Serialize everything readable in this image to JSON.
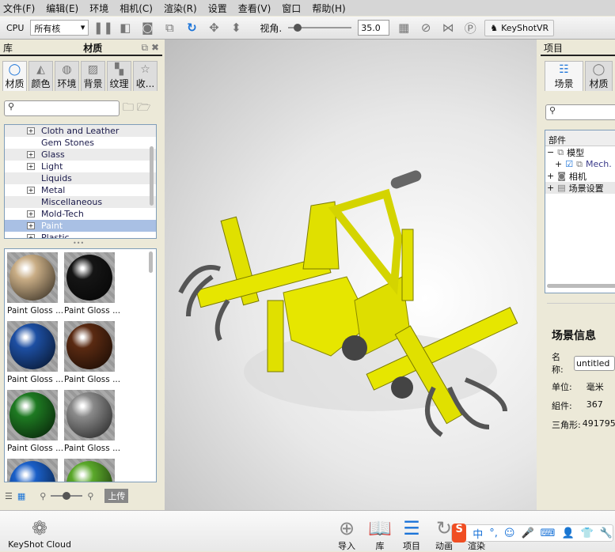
{
  "menu": [
    "文件(F)",
    "编辑(E)",
    "环境",
    "相机(C)",
    "渲染(R)",
    "设置",
    "查看(V)",
    "窗口",
    "帮助(H)"
  ],
  "toolbar": {
    "cpu_label": "CPU",
    "cpu_select": "所有核",
    "fov_label": "视角.",
    "fov_value": "35.0",
    "fov_slider": 0.1,
    "keyshotvr": "KeyShotVR"
  },
  "library": {
    "title_left": "库",
    "title": "材质",
    "tabs": [
      "材质",
      "颜色",
      "环境",
      "背景",
      "纹理",
      "收..."
    ],
    "tab_icons": [
      "material-icon",
      "color-icon",
      "globe-icon",
      "image-icon",
      "texture-icon",
      "star-icon"
    ],
    "tree": [
      {
        "label": "Cloth and Leather",
        "exp": true
      },
      {
        "label": "Gem Stones",
        "exp": false
      },
      {
        "label": "Glass",
        "exp": true
      },
      {
        "label": "Light",
        "exp": true
      },
      {
        "label": "Liquids",
        "exp": false
      },
      {
        "label": "Metal",
        "exp": true
      },
      {
        "label": "Miscellaneous",
        "exp": false
      },
      {
        "label": "Mold-Tech",
        "exp": true
      },
      {
        "label": "Paint",
        "exp": true,
        "selected": true
      },
      {
        "label": "Plastic",
        "exp": true
      }
    ],
    "materials": [
      {
        "label": "Paint Gloss ...",
        "color": "#c9ad85"
      },
      {
        "label": "Paint Gloss ...",
        "color": "#151515"
      },
      {
        "label": "Paint Gloss ...",
        "color": "#1d4fa3"
      },
      {
        "label": "Paint Gloss ...",
        "color": "#5a2a12"
      },
      {
        "label": "Paint Gloss ...",
        "color": "#1e7a22"
      },
      {
        "label": "Paint Gloss ...",
        "color": "#8a8a8a"
      },
      {
        "label": "Paint Gloss ...",
        "color": "#1a5fc8"
      },
      {
        "label": "Paint Gloss ...",
        "color": "#5aa82a"
      }
    ],
    "upload": "上传",
    "thumb_size": 0.5
  },
  "project": {
    "title": "项目",
    "tabs": [
      "场景",
      "材质"
    ],
    "tree_header": "部件",
    "tree": [
      {
        "label": "模型",
        "sign": "−"
      },
      {
        "label": "Mech.",
        "sign": "+",
        "child": true
      },
      {
        "label": "相机",
        "sign": "+"
      },
      {
        "label": "场景设置",
        "sign": "+"
      }
    ],
    "info_title": "场景信息",
    "name_label": "名称:",
    "name_value": "untitled",
    "unit_label": "单位:",
    "unit_value": "毫米",
    "parts_label": "組件:",
    "parts_value": "367",
    "tri_label": "三角形:",
    "tri_value": "491795"
  },
  "bottom": {
    "cloud": "KeyShot Cloud",
    "items": [
      "导入",
      "库",
      "项目",
      "动画",
      "渲染"
    ]
  },
  "ime": {
    "lang": "中",
    "punct": "°,"
  }
}
